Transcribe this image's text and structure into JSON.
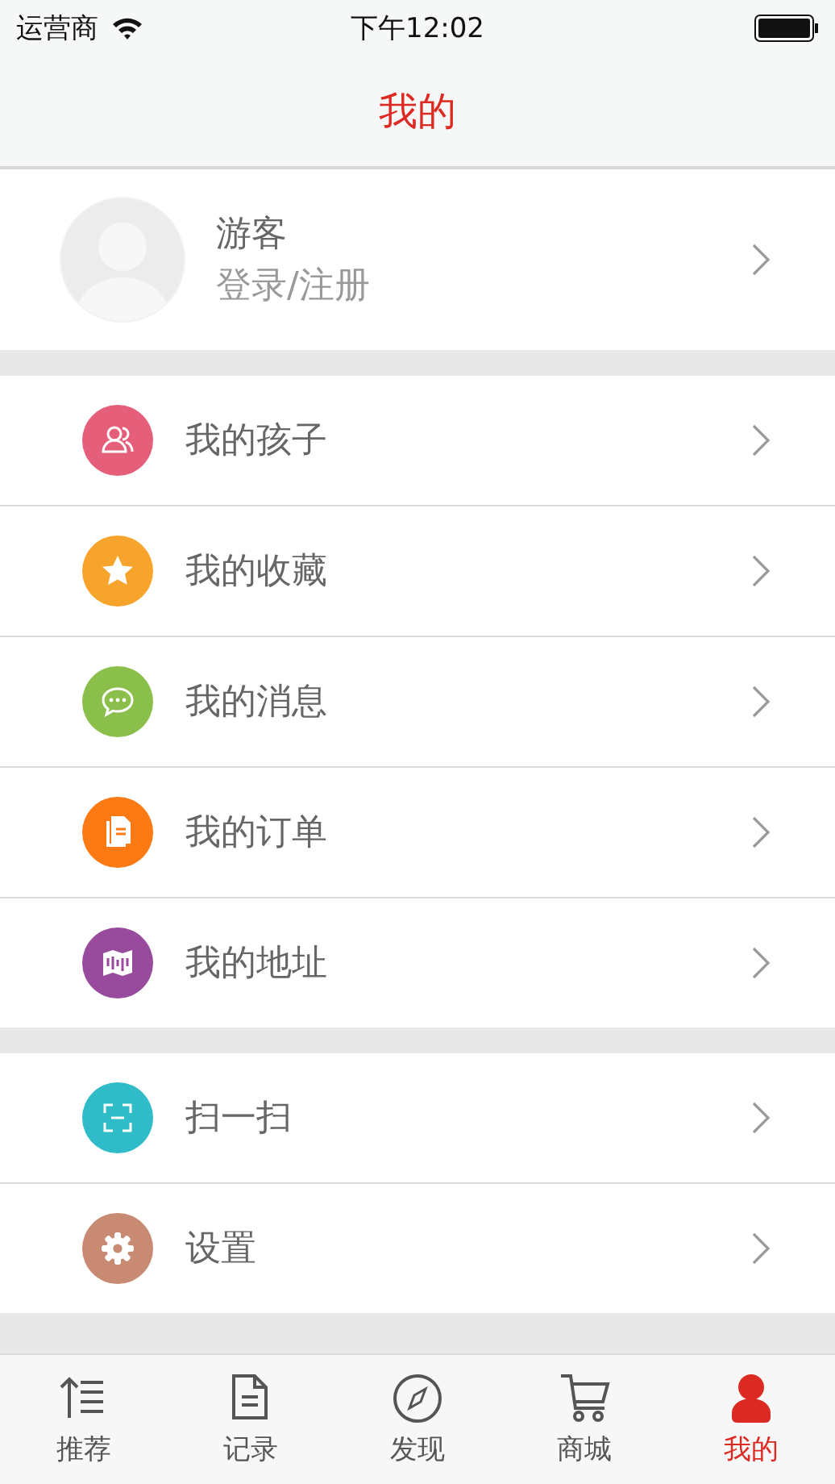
{
  "status_bar": {
    "carrier": "运营商",
    "time": "下午12:02"
  },
  "nav": {
    "title": "我的"
  },
  "profile": {
    "name": "游客",
    "action": "登录/注册"
  },
  "sections": [
    {
      "items": [
        {
          "label": "我的孩子",
          "kind": "people",
          "color": "#e65f7a"
        },
        {
          "label": "我的收藏",
          "kind": "star",
          "color": "#f7a42c"
        },
        {
          "label": "我的消息",
          "kind": "chat",
          "color": "#8bbf4c"
        },
        {
          "label": "我的订单",
          "kind": "document",
          "color": "#fb7a13"
        },
        {
          "label": "我的地址",
          "kind": "map",
          "color": "#984a9c"
        }
      ]
    },
    {
      "items": [
        {
          "label": "扫一扫",
          "kind": "scan",
          "color": "#2fbcc8"
        },
        {
          "label": "设置",
          "kind": "gear",
          "color": "#c88a72"
        }
      ]
    }
  ],
  "tabs": [
    {
      "label": "推荐",
      "kind": "list",
      "selected": false
    },
    {
      "label": "记录",
      "kind": "document",
      "selected": false
    },
    {
      "label": "发现",
      "kind": "compass",
      "selected": false
    },
    {
      "label": "商城",
      "kind": "cart",
      "selected": false
    },
    {
      "label": "我的",
      "kind": "person",
      "selected": true
    }
  ]
}
